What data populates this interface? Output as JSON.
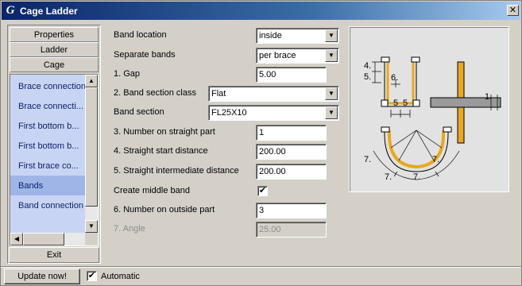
{
  "window": {
    "title": "Cage Ladder",
    "logo_glyph": "G",
    "close_glyph": "✕"
  },
  "sidebar": {
    "buttons": [
      "Properties",
      "Ladder",
      "Cage"
    ],
    "items": [
      {
        "label": "Brace connection",
        "selected": false
      },
      {
        "label": "Brace connecti...",
        "selected": false
      },
      {
        "label": "First bottom b...",
        "selected": false
      },
      {
        "label": "First bottom b...",
        "selected": false
      },
      {
        "label": "First brace co...",
        "selected": false
      },
      {
        "label": "Bands",
        "selected": true
      },
      {
        "label": "Band connection",
        "selected": false
      }
    ],
    "exit_label": "Exit",
    "scroll_glyphs": {
      "up": "▲",
      "down": "▼",
      "left": "◀",
      "right": "▶"
    }
  },
  "form": {
    "band_location": {
      "label": "Band location",
      "value": "inside"
    },
    "separate_bands": {
      "label": "Separate bands",
      "value": "per brace"
    },
    "gap": {
      "label": "1. Gap",
      "value": "5.00"
    },
    "band_section_class": {
      "label": "2. Band section class",
      "value": "Flat"
    },
    "band_section": {
      "label": "Band section",
      "value": "FL25X10"
    },
    "number_straight": {
      "label": "3. Number on straight part",
      "value": "1"
    },
    "straight_start": {
      "label": "4. Straight start distance",
      "value": "200.00"
    },
    "straight_intermediate": {
      "label": "5. Straight intermediate distance",
      "value": "200.00"
    },
    "create_middle_band": {
      "label": "Create middle band",
      "checked": true
    },
    "number_outside": {
      "label": "6. Number on outside part",
      "value": "3"
    },
    "angle": {
      "label": "7. Angle",
      "value": "25.00",
      "disabled": true
    },
    "check_glyph": "✔"
  },
  "preview": {
    "labels": {
      "n1": "1.",
      "n4": "4.",
      "n5": "5.",
      "n5b": "5",
      "n5c": "5",
      "n6": "6.",
      "n7a": "7.",
      "n7b": "7.",
      "n7c": "7.",
      "n7d": "7."
    },
    "colors": {
      "band": "#e8a820",
      "steel": "#9a9a9a",
      "outline": "#000000"
    }
  },
  "footer": {
    "update_label": "Update now!",
    "automatic_label": "Automatic",
    "automatic_checked": true
  }
}
